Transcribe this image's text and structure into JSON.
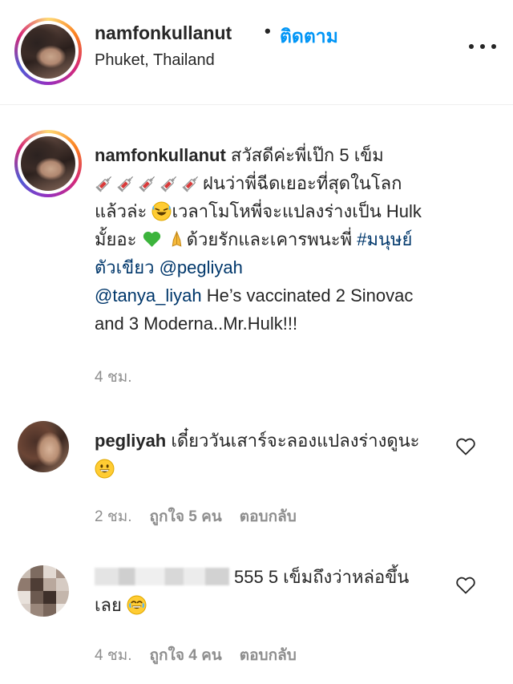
{
  "header": {
    "username": "namfonkullanut",
    "separator": "•",
    "follow_label": "ติดตาม",
    "location": "Phuket, Thailand",
    "more_icon": "more-horizontal-icon"
  },
  "caption": {
    "username": "namfonkullanut",
    "text_1": " สวัสดีค่ะพี่เป๊ก 5 เข็ม ",
    "syringe_icon": "syringe-icon",
    "text_2": "ฝนว่าพี่ฉีดเยอะที่สุดในโลกแล้วล่ะ",
    "emoji_1": "rofl-emoji",
    "text_3": "เวลาโมโหพี่จะแปลงร่างเป็น Hulk มั้ยอะ",
    "emoji_2": "green-heart-emoji",
    "emoji_3": "folded-hands-emoji",
    "text_4": "ด้วยรักและเคารพนะพี่ ",
    "hashtag": "#มนุษย์ตัวเขียว",
    "mention_1": "@pegliyah",
    "mention_2": "@tanya_liyah",
    "text_5": " He’s vaccinated 2 Sinovac and 3 Moderna..Mr.Hulk!!!",
    "time": "4 ชม."
  },
  "comments": [
    {
      "username": "pegliyah",
      "text": " เดี๋ยววันเสาร์จะลองแปลงร่างดูนะ",
      "emoji": "grinning-emoji",
      "time": "2 ชม.",
      "likes": "ถูกใจ 5 คน",
      "reply": "ตอบกลับ"
    },
    {
      "username_hidden": true,
      "text": "555 5 เข็มถึงว่าหล่อขึ้นเลย",
      "emoji": "joy-emoji",
      "time": "4 ชม.",
      "likes": "ถูกใจ 4 คน",
      "reply": "ตอบกลับ"
    }
  ],
  "colors": {
    "link": "#00376b",
    "follow": "#0095f6",
    "meta": "#8e8e8e",
    "text": "#262626"
  }
}
